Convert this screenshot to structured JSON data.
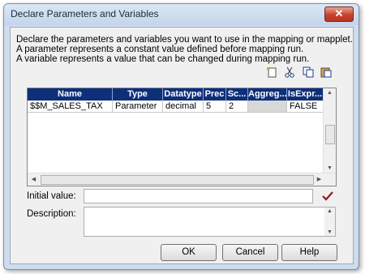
{
  "window": {
    "title": "Declare Parameters and Variables",
    "close_glyph": "✕"
  },
  "description": {
    "line1": "Declare the parameters and variables you want to use in the mapping or mapplet.",
    "line2": "A parameter represents a constant value defined before mapping run.",
    "line3": "A variable represents a value that can be changed during mapping run."
  },
  "toolbar": {
    "icons": [
      "new-icon",
      "cut-icon",
      "copy-icon",
      "paste-icon"
    ]
  },
  "grid": {
    "columns": [
      "Name",
      "Type",
      "Datatype",
      "Prec",
      "Sc...",
      "Aggreg...",
      "IsExpr..."
    ],
    "rows": [
      [
        "$$M_SALES_TAX",
        "Parameter",
        "decimal",
        "5",
        "2",
        "",
        "FALSE"
      ]
    ]
  },
  "fields": {
    "initial_value_label": "Initial value:",
    "initial_value": "",
    "description_label": "Description:",
    "description_value": ""
  },
  "buttons": {
    "ok": "OK",
    "cancel": "Cancel",
    "help": "Help"
  },
  "colors": {
    "header_bg": "#0e2f7a",
    "validate_check": "#8b1a1a"
  }
}
